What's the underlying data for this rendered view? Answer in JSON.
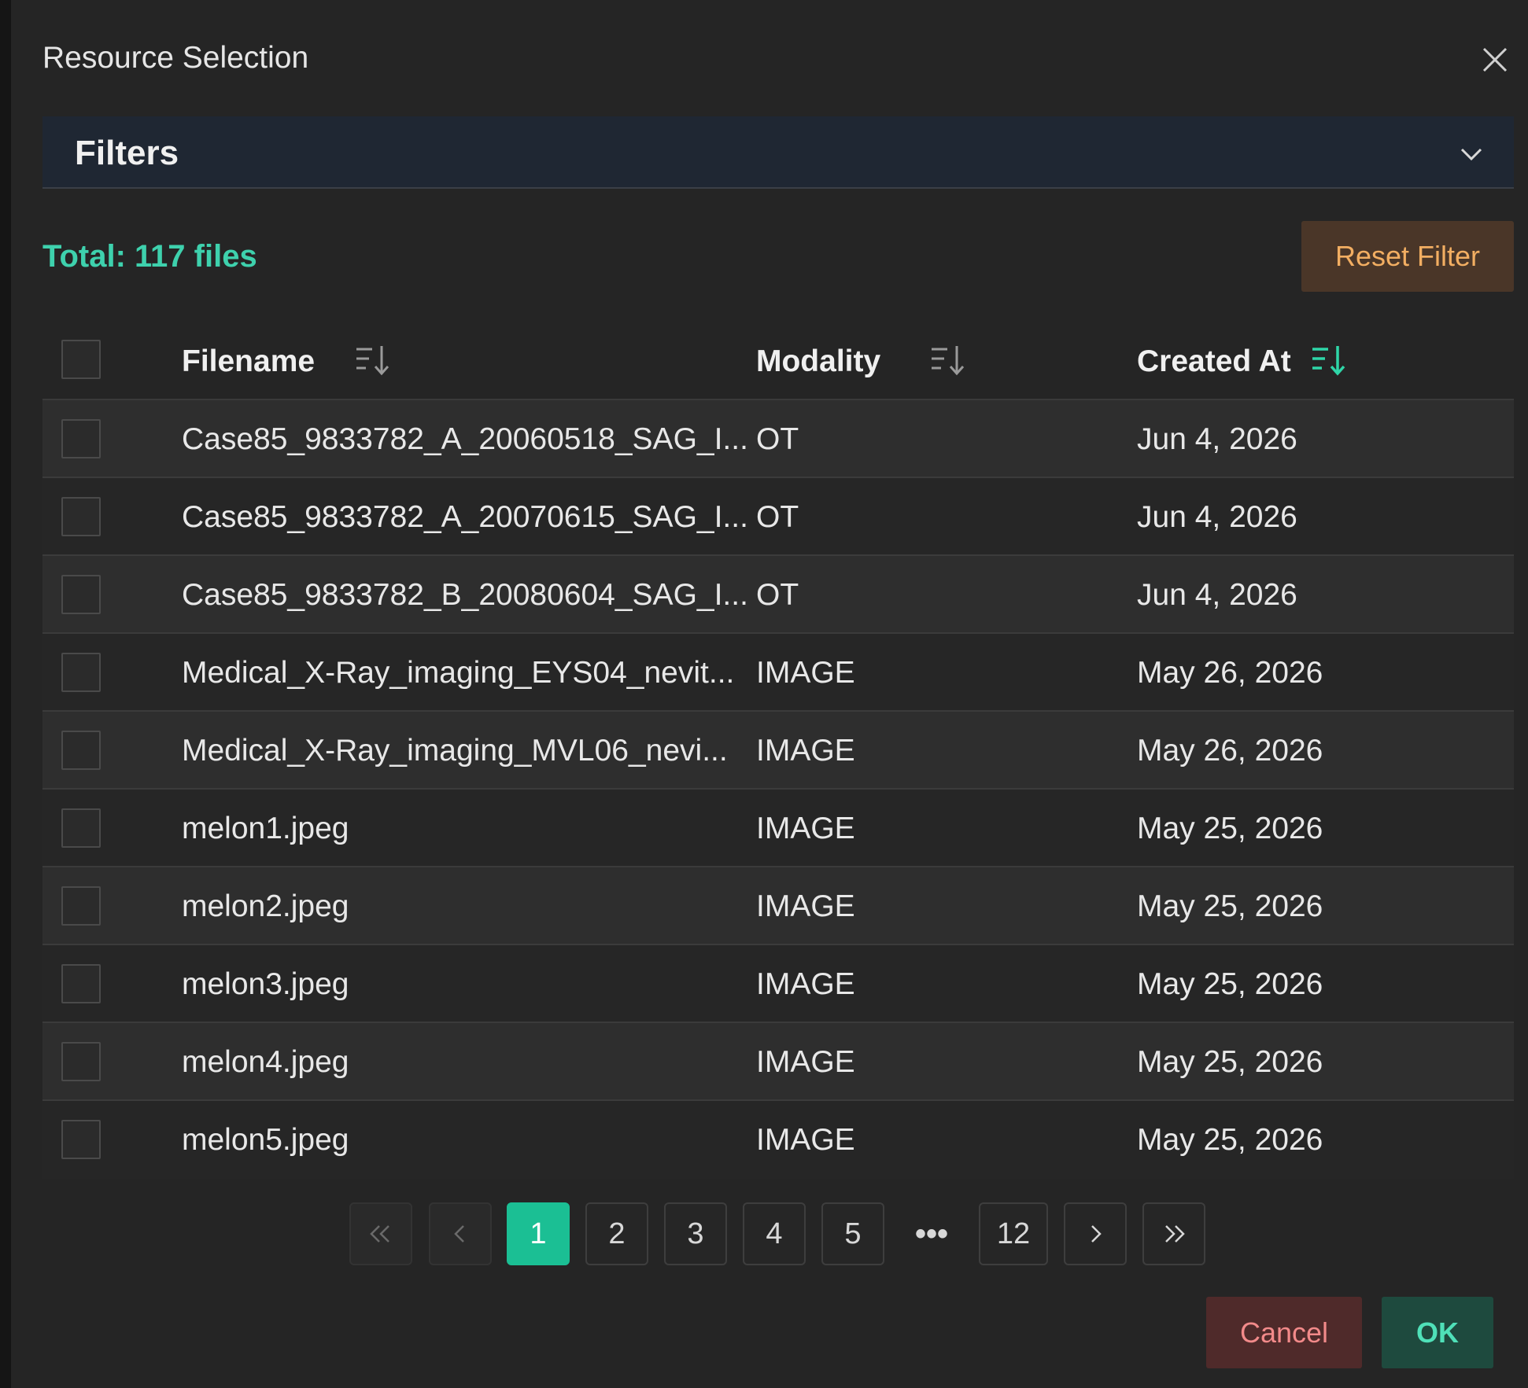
{
  "dialog": {
    "title": "Resource Selection"
  },
  "filters": {
    "title": "Filters"
  },
  "summary": {
    "total_text": "Total: 117 files",
    "reset_label": "Reset Filter"
  },
  "table": {
    "columns": {
      "filename": "Filename",
      "modality": "Modality",
      "created_at": "Created At"
    },
    "rows": [
      {
        "filename": "Case85_9833782_A_20060518_SAG_I...",
        "modality": "OT",
        "created_at": "Jun 4, 2026"
      },
      {
        "filename": "Case85_9833782_A_20070615_SAG_I...",
        "modality": "OT",
        "created_at": "Jun 4, 2026"
      },
      {
        "filename": "Case85_9833782_B_20080604_SAG_I...",
        "modality": "OT",
        "created_at": "Jun 4, 2026"
      },
      {
        "filename": "Medical_X-Ray_imaging_EYS04_nevit...",
        "modality": "IMAGE",
        "created_at": "May 26, 2026"
      },
      {
        "filename": "Medical_X-Ray_imaging_MVL06_nevi...",
        "modality": "IMAGE",
        "created_at": "May 26, 2026"
      },
      {
        "filename": "melon1.jpeg",
        "modality": "IMAGE",
        "created_at": "May 25, 2026"
      },
      {
        "filename": "melon2.jpeg",
        "modality": "IMAGE",
        "created_at": "May 25, 2026"
      },
      {
        "filename": "melon3.jpeg",
        "modality": "IMAGE",
        "created_at": "May 25, 2026"
      },
      {
        "filename": "melon4.jpeg",
        "modality": "IMAGE",
        "created_at": "May 25, 2026"
      },
      {
        "filename": "melon5.jpeg",
        "modality": "IMAGE",
        "created_at": "May 25, 2026"
      }
    ]
  },
  "pagination": {
    "first_icon": "double-chevron-left-icon",
    "prev_icon": "chevron-left-icon",
    "pages": [
      "1",
      "2",
      "3",
      "4",
      "5"
    ],
    "ellipsis": "•••",
    "last_page": "12",
    "next_icon": "chevron-right-icon",
    "last_icon": "double-chevron-right-icon",
    "current": "1"
  },
  "footer": {
    "cancel_label": "Cancel",
    "ok_label": "OK"
  },
  "colors": {
    "accent": "#1bbf94",
    "total_text": "#3ed1ad",
    "reset_bg": "#4a3628",
    "reset_text": "#f2ae62",
    "cancel_bg": "#4f2a2a",
    "cancel_text": "#f28a8a",
    "ok_bg": "#1e4a3e",
    "ok_text": "#4fe0b8"
  }
}
